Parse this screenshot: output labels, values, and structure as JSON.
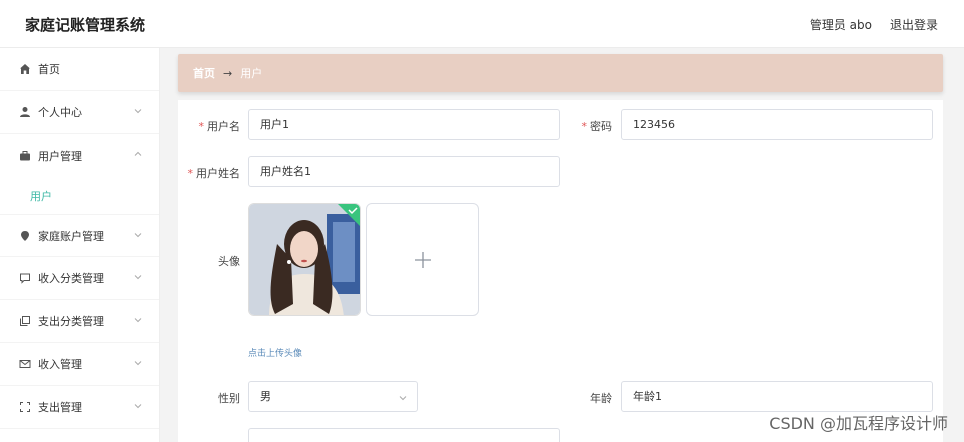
{
  "header": {
    "title": "家庭记账管理系统",
    "admin": "管理员 abo",
    "logout": "退出登录"
  },
  "sidebar": {
    "items": [
      {
        "label": "首页",
        "icon": "home-icon",
        "chevron": false
      },
      {
        "label": "个人中心",
        "icon": "user-icon",
        "chevron": true
      },
      {
        "label": "用户管理",
        "icon": "briefcase-icon",
        "chevron": true,
        "expanded": true
      },
      {
        "label": "家庭账户管理",
        "icon": "location-icon",
        "chevron": true
      },
      {
        "label": "收入分类管理",
        "icon": "chat-icon",
        "chevron": true
      },
      {
        "label": "支出分类管理",
        "icon": "copy-icon",
        "chevron": true
      },
      {
        "label": "收入管理",
        "icon": "mail-icon",
        "chevron": true
      },
      {
        "label": "支出管理",
        "icon": "fullscreen-icon",
        "chevron": true
      }
    ],
    "sub_item": "用户"
  },
  "breadcrumb": {
    "home": "首页",
    "arrow": "→",
    "current": "用户"
  },
  "form": {
    "username_label": "用户名",
    "username_value": "用户1",
    "password_label": "密码",
    "password_value": "123456",
    "realname_label": "用户姓名",
    "realname_value": "用户姓名1",
    "avatar_label": "头像",
    "upload_hint": "点击上传头像",
    "gender_label": "性别",
    "gender_value": "男",
    "age_label": "年龄",
    "age_value": "年龄1"
  },
  "watermark": "CSDN @加瓦程序设计师",
  "colors": {
    "accent": "#3fb9a6",
    "breadcrumb_bg": "#e8cfc3",
    "required": "#e05555"
  }
}
